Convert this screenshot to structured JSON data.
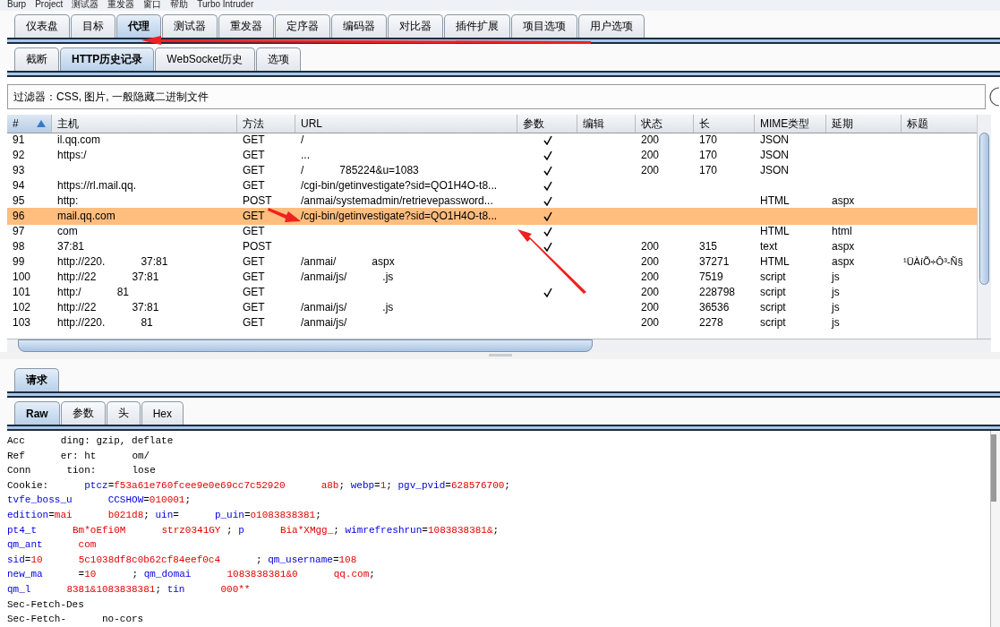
{
  "menu": [
    "Burp",
    "Project",
    "测试器",
    "重发器",
    "窗口",
    "帮助",
    "Turbo Intruder"
  ],
  "tabs": [
    {
      "label": "仪表盘",
      "selected": false
    },
    {
      "label": "目标",
      "selected": false
    },
    {
      "label": "代理",
      "selected": true
    },
    {
      "label": "测试器",
      "selected": false
    },
    {
      "label": "重发器",
      "selected": false
    },
    {
      "label": "定序器",
      "selected": false
    },
    {
      "label": "编码器",
      "selected": false
    },
    {
      "label": "对比器",
      "selected": false
    },
    {
      "label": "插件扩展",
      "selected": false
    },
    {
      "label": "项目选项",
      "selected": false
    },
    {
      "label": "用户选项",
      "selected": false
    }
  ],
  "subtabs": [
    {
      "label": "截断",
      "selected": false
    },
    {
      "label": "HTTP历史记录",
      "selected": true
    },
    {
      "label": "WebSocket历史",
      "selected": false
    },
    {
      "label": "选项",
      "selected": false
    }
  ],
  "filter": {
    "value": "过滤器：CSS, 图片, 一般隐藏二进制文件"
  },
  "table": {
    "columns": [
      {
        "label": "#",
        "sorted": true
      },
      {
        "label": "主机",
        "sorted": false
      },
      {
        "label": "方法",
        "sorted": false
      },
      {
        "label": "URL",
        "sorted": false
      },
      {
        "label": "参数",
        "sorted": false
      },
      {
        "label": "编辑",
        "sorted": false
      },
      {
        "label": "状态",
        "sorted": false
      },
      {
        "label": "长",
        "sorted": false
      },
      {
        "label": "MIME类型",
        "sorted": false
      },
      {
        "label": "延期",
        "sorted": false
      },
      {
        "label": "标题",
        "sorted": false
      }
    ],
    "rows": [
      {
        "num": "91",
        "host": [
          "il.qq.com"
        ],
        "method": "GET",
        "url": [
          "/"
        ],
        "params": true,
        "status": "200",
        "length": "170",
        "mime": "JSON",
        "selected": false
      },
      {
        "num": "92",
        "host": [
          "https:/"
        ],
        "method": "GET",
        "url": [
          "..."
        ],
        "params": true,
        "status": "200",
        "length": "170",
        "mime": "JSON",
        "selected": false
      },
      {
        "num": "93",
        "method": "GET",
        "url": [
          "/",
          "785224&u=1083"
        ],
        "params": true,
        "status": "200",
        "length": "170",
        "mime": "JSON",
        "selected": false
      },
      {
        "num": "94",
        "host": [
          "https://rl.mail.qq."
        ],
        "method": "GET",
        "url": [
          "/cgi-bin/getinvestigate?sid=QO1H4O-t8..."
        ],
        "params": true,
        "selected": false
      },
      {
        "num": "95",
        "host": [
          "http:"
        ],
        "method": "POST",
        "url": [
          "/anmai/systemadmin/retrievepassword..."
        ],
        "params": true,
        "mime": "HTML",
        "ext": "aspx",
        "selected": false
      },
      {
        "num": "96",
        "host": [
          "mail.qq.com"
        ],
        "method": "GET",
        "url": [
          "/cgi-bin/getinvestigate?sid=QO1H4O-t8..."
        ],
        "params": true,
        "selected": true
      },
      {
        "num": "97",
        "host": [
          "com"
        ],
        "method": "GET",
        "params": true,
        "mime": "HTML",
        "ext": "html",
        "selected": false
      },
      {
        "num": "98",
        "host": [
          "37:81"
        ],
        "method": "POST",
        "params": true,
        "status": "200",
        "length": "315",
        "mime": "text",
        "ext": "aspx",
        "selected": false
      },
      {
        "num": "99",
        "host": [
          "http://220.",
          "37:81"
        ],
        "method": "GET",
        "url": [
          "/anmai/",
          "aspx"
        ],
        "params": false,
        "status": "200",
        "length": "37271",
        "mime": "HTML",
        "ext": "aspx",
        "title": "¹ÜÀíÕ÷Ô³-Ñ§",
        "selected": false
      },
      {
        "num": "100",
        "host": [
          "http://22",
          "37:81"
        ],
        "method": "GET",
        "url": [
          "/anmai/js/",
          ".js"
        ],
        "params": false,
        "status": "200",
        "length": "7519",
        "mime": "script",
        "ext": "js",
        "selected": false
      },
      {
        "num": "101",
        "host": [
          "http:/",
          "81"
        ],
        "method": "GET",
        "params": true,
        "status": "200",
        "length": "228798",
        "mime": "script",
        "ext": "js",
        "selected": false
      },
      {
        "num": "102",
        "host": [
          "http://22",
          "37:81"
        ],
        "method": "GET",
        "url": [
          "/anmai/js/",
          ".js"
        ],
        "params": false,
        "status": "200",
        "length": "36536",
        "mime": "script",
        "ext": "js",
        "selected": false
      },
      {
        "num": "103",
        "host": [
          "http://220.",
          "81"
        ],
        "method": "GET",
        "url": [
          "/anmai/js/"
        ],
        "params": false,
        "status": "200",
        "length": "2278",
        "mime": "script",
        "ext": "js",
        "selected": false
      }
    ]
  },
  "detail_tabs": [
    {
      "label": "请求",
      "selected": true
    }
  ],
  "view_tabs": [
    {
      "label": "Raw",
      "selected": true
    },
    {
      "label": "参数",
      "selected": false
    },
    {
      "label": "头",
      "selected": false
    },
    {
      "label": "Hex",
      "selected": false
    }
  ],
  "request_lines": [
    [
      [
        {
          "kind": "plain",
          "text": "Acc"
        }
      ],
      [
        {
          "kind": "plain",
          "text": "ding: gzip, deflate"
        }
      ]
    ],
    [
      [
        {
          "kind": "plain",
          "text": "Ref"
        }
      ],
      [
        {
          "kind": "plain",
          "text": "er: ht"
        }
      ],
      [
        {
          "kind": "plain",
          "text": "om/"
        }
      ]
    ],
    [
      [
        {
          "kind": "plain",
          "text": "Conn"
        }
      ],
      [
        {
          "kind": "plain",
          "text": "tion:"
        }
      ],
      [
        {
          "kind": "plain",
          "text": "lose"
        }
      ]
    ],
    [
      [
        {
          "kind": "plain",
          "text": "Cookie:"
        }
      ],
      [
        {
          "kind": "key",
          "text": "ptcz"
        },
        {
          "kind": "plain",
          "text": "="
        },
        {
          "kind": "val",
          "text": "f53a61e760fcee9e0e69cc7c52920"
        }
      ],
      [
        {
          "kind": "val",
          "text": "a8b"
        },
        {
          "kind": "plain",
          "text": "; "
        },
        {
          "kind": "key",
          "text": "webp"
        },
        {
          "kind": "plain",
          "text": "="
        },
        {
          "kind": "val",
          "text": "1"
        },
        {
          "kind": "plain",
          "text": "; "
        },
        {
          "kind": "key",
          "text": "pgv_pvid"
        },
        {
          "kind": "plain",
          "text": "="
        },
        {
          "kind": "val",
          "text": "628576700"
        },
        {
          "kind": "plain",
          "text": ";"
        }
      ]
    ],
    [
      [
        {
          "kind": "key",
          "text": "tvfe_boss_u"
        }
      ],
      [
        {
          "kind": "key",
          "text": "CCSHOW"
        },
        {
          "kind": "plain",
          "text": "="
        },
        {
          "kind": "val",
          "text": "010001"
        },
        {
          "kind": "plain",
          "text": ";"
        }
      ]
    ],
    [
      [
        {
          "kind": "key",
          "text": "edition"
        },
        {
          "kind": "plain",
          "text": "="
        },
        {
          "kind": "val",
          "text": "mai"
        }
      ],
      [
        {
          "kind": "val",
          "text": "b021d8"
        },
        {
          "kind": "plain",
          "text": "; "
        },
        {
          "kind": "key",
          "text": "uin"
        },
        {
          "kind": "plain",
          "text": "="
        }
      ],
      [
        {
          "kind": "key",
          "text": "p_uin"
        },
        {
          "kind": "plain",
          "text": "="
        },
        {
          "kind": "val",
          "text": "o1083838381"
        },
        {
          "kind": "plain",
          "text": ";"
        }
      ]
    ],
    [
      [
        {
          "kind": "key",
          "text": "pt4_t"
        }
      ],
      [
        {
          "kind": "val",
          "text": "Bm*oEfi0M"
        }
      ],
      [
        {
          "kind": "val",
          "text": "strz0341GY"
        },
        {
          "kind": "plain",
          "text": " ; "
        },
        {
          "kind": "key",
          "text": "p"
        }
      ],
      [
        {
          "kind": "val",
          "text": "Bia*XMgg_"
        },
        {
          "kind": "plain",
          "text": "; "
        },
        {
          "kind": "key",
          "text": "wimrefreshrun"
        },
        {
          "kind": "plain",
          "text": "="
        },
        {
          "kind": "val",
          "text": "1083838381&"
        },
        {
          "kind": "plain",
          "text": ";"
        }
      ]
    ],
    [
      [
        {
          "kind": "key",
          "text": "qm_ant"
        }
      ],
      [
        {
          "kind": "val",
          "text": "com"
        }
      ]
    ],
    [
      [
        {
          "kind": "key",
          "text": "sid"
        },
        {
          "kind": "plain",
          "text": "="
        },
        {
          "kind": "val",
          "text": "10"
        }
      ],
      [
        {
          "kind": "val",
          "text": "5c1038df8c0b62cf84eef0c4"
        }
      ],
      [
        {
          "kind": "plain",
          "text": "; "
        },
        {
          "kind": "key",
          "text": "qm_username"
        },
        {
          "kind": "plain",
          "text": "="
        },
        {
          "kind": "val",
          "text": "108"
        }
      ]
    ],
    [
      [
        {
          "kind": "key",
          "text": "new_ma"
        }
      ],
      [
        {
          "kind": "plain",
          "text": "="
        },
        {
          "kind": "val",
          "text": "10"
        }
      ],
      [
        {
          "kind": "plain",
          "text": "; "
        },
        {
          "kind": "key",
          "text": "qm_domai"
        }
      ],
      [
        {
          "kind": "val",
          "text": "1083838381&0"
        }
      ],
      [
        {
          "kind": "val",
          "text": "qq.com"
        },
        {
          "kind": "plain",
          "text": ";"
        }
      ]
    ],
    [
      [
        {
          "kind": "key",
          "text": "qm_l"
        }
      ],
      [
        {
          "kind": "val",
          "text": "8381&1083838381"
        },
        {
          "kind": "plain",
          "text": "; "
        },
        {
          "kind": "key",
          "text": "tin"
        }
      ],
      [
        {
          "kind": "val",
          "text": "000**"
        }
      ]
    ],
    [
      [
        {
          "kind": "plain",
          "text": "Sec-Fetch-Des"
        }
      ]
    ],
    [
      [
        {
          "kind": "plain",
          "text": "Sec-Fetch-"
        }
      ],
      [
        {
          "kind": "plain",
          "text": "no-cors"
        }
      ]
    ]
  ]
}
